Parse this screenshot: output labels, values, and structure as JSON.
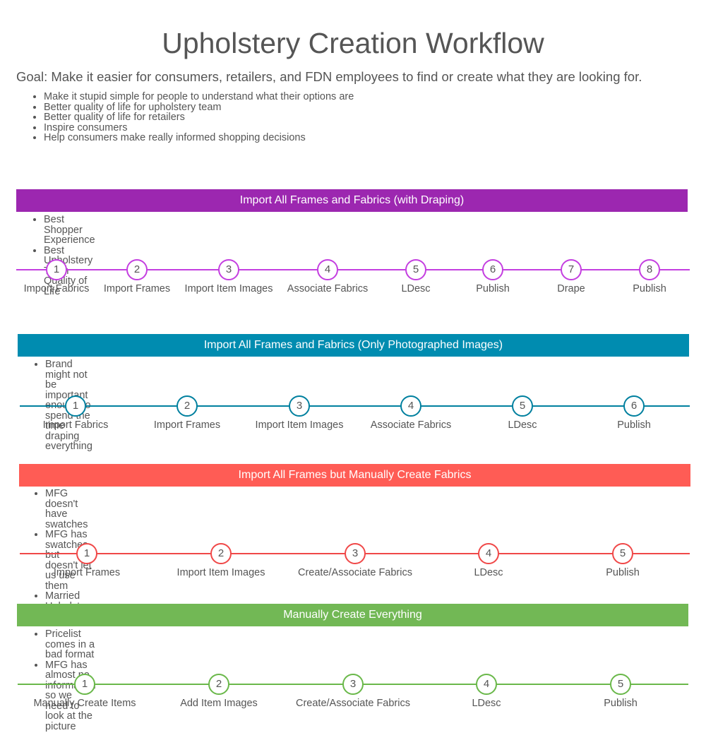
{
  "title": "Upholstery Creation Workflow",
  "goal": "Goal: Make it easier for consumers, retailers, and FDN employees to find or create what they are looking for.",
  "goal_points": [
    "Make it stupid simple for people to understand what their options are",
    "Better quality of life for upholstery team",
    "Better quality of life for retailers",
    "Inspire consumers",
    "Help consumers make really informed shopping decisions"
  ],
  "workflows": [
    {
      "title": "Import All Frames and Fabrics (with Draping)",
      "color": "#9c27b0",
      "line_color": "#c43fe0",
      "notes": [
        "Best Shopper Experience",
        "Best Upholstery Team Quality of Life"
      ],
      "steps": [
        {
          "number": "1",
          "label": "Import Fabrics"
        },
        {
          "number": "2",
          "label": "Import Frames"
        },
        {
          "number": "3",
          "label": "Import Item Images"
        },
        {
          "number": "4",
          "label": "Associate Fabrics"
        },
        {
          "number": "5",
          "label": "LDesc"
        },
        {
          "number": "6",
          "label": "Publish"
        },
        {
          "number": "7",
          "label": "Drape"
        },
        {
          "number": "8",
          "label": "Publish"
        }
      ]
    },
    {
      "title": "Import All Frames and Fabrics (Only Photographed Images)",
      "color": "#008cb0",
      "line_color": "#00809f",
      "notes": [
        "Brand might not be important enough to spend the time draping everything"
      ],
      "steps": [
        {
          "number": "1",
          "label": "Import Fabrics"
        },
        {
          "number": "2",
          "label": "Import Frames"
        },
        {
          "number": "3",
          "label": "Import Item Images"
        },
        {
          "number": "4",
          "label": "Associate Fabrics"
        },
        {
          "number": "5",
          "label": "LDesc"
        },
        {
          "number": "6",
          "label": "Publish"
        }
      ]
    },
    {
      "title": "Import All Frames but Manually Create Fabrics",
      "color": "#ff5c55",
      "line_color": "#f04848",
      "notes": [
        "MFG doesn't have swatches",
        "MFG has swatches but doesn't let us use them",
        "Married Upholstery"
      ],
      "steps": [
        {
          "number": "1",
          "label": "Import Frames"
        },
        {
          "number": "2",
          "label": "Import Item Images"
        },
        {
          "number": "3",
          "label": "Create/Associate Fabrics"
        },
        {
          "number": "4",
          "label": "LDesc"
        },
        {
          "number": "5",
          "label": "Publish"
        }
      ]
    },
    {
      "title": "Manually Create Everything",
      "color": "#72b855",
      "line_color": "#6ab84a",
      "notes": [
        "Pricelist comes in a bad format",
        "MFG has almost no information so we need to look at the picture"
      ],
      "steps": [
        {
          "number": "1",
          "label": "Manually Create Items"
        },
        {
          "number": "2",
          "label": "Add Item Images"
        },
        {
          "number": "3",
          "label": "Create/Associate Fabrics"
        },
        {
          "number": "4",
          "label": "LDesc"
        },
        {
          "number": "5",
          "label": "Publish"
        }
      ]
    }
  ]
}
